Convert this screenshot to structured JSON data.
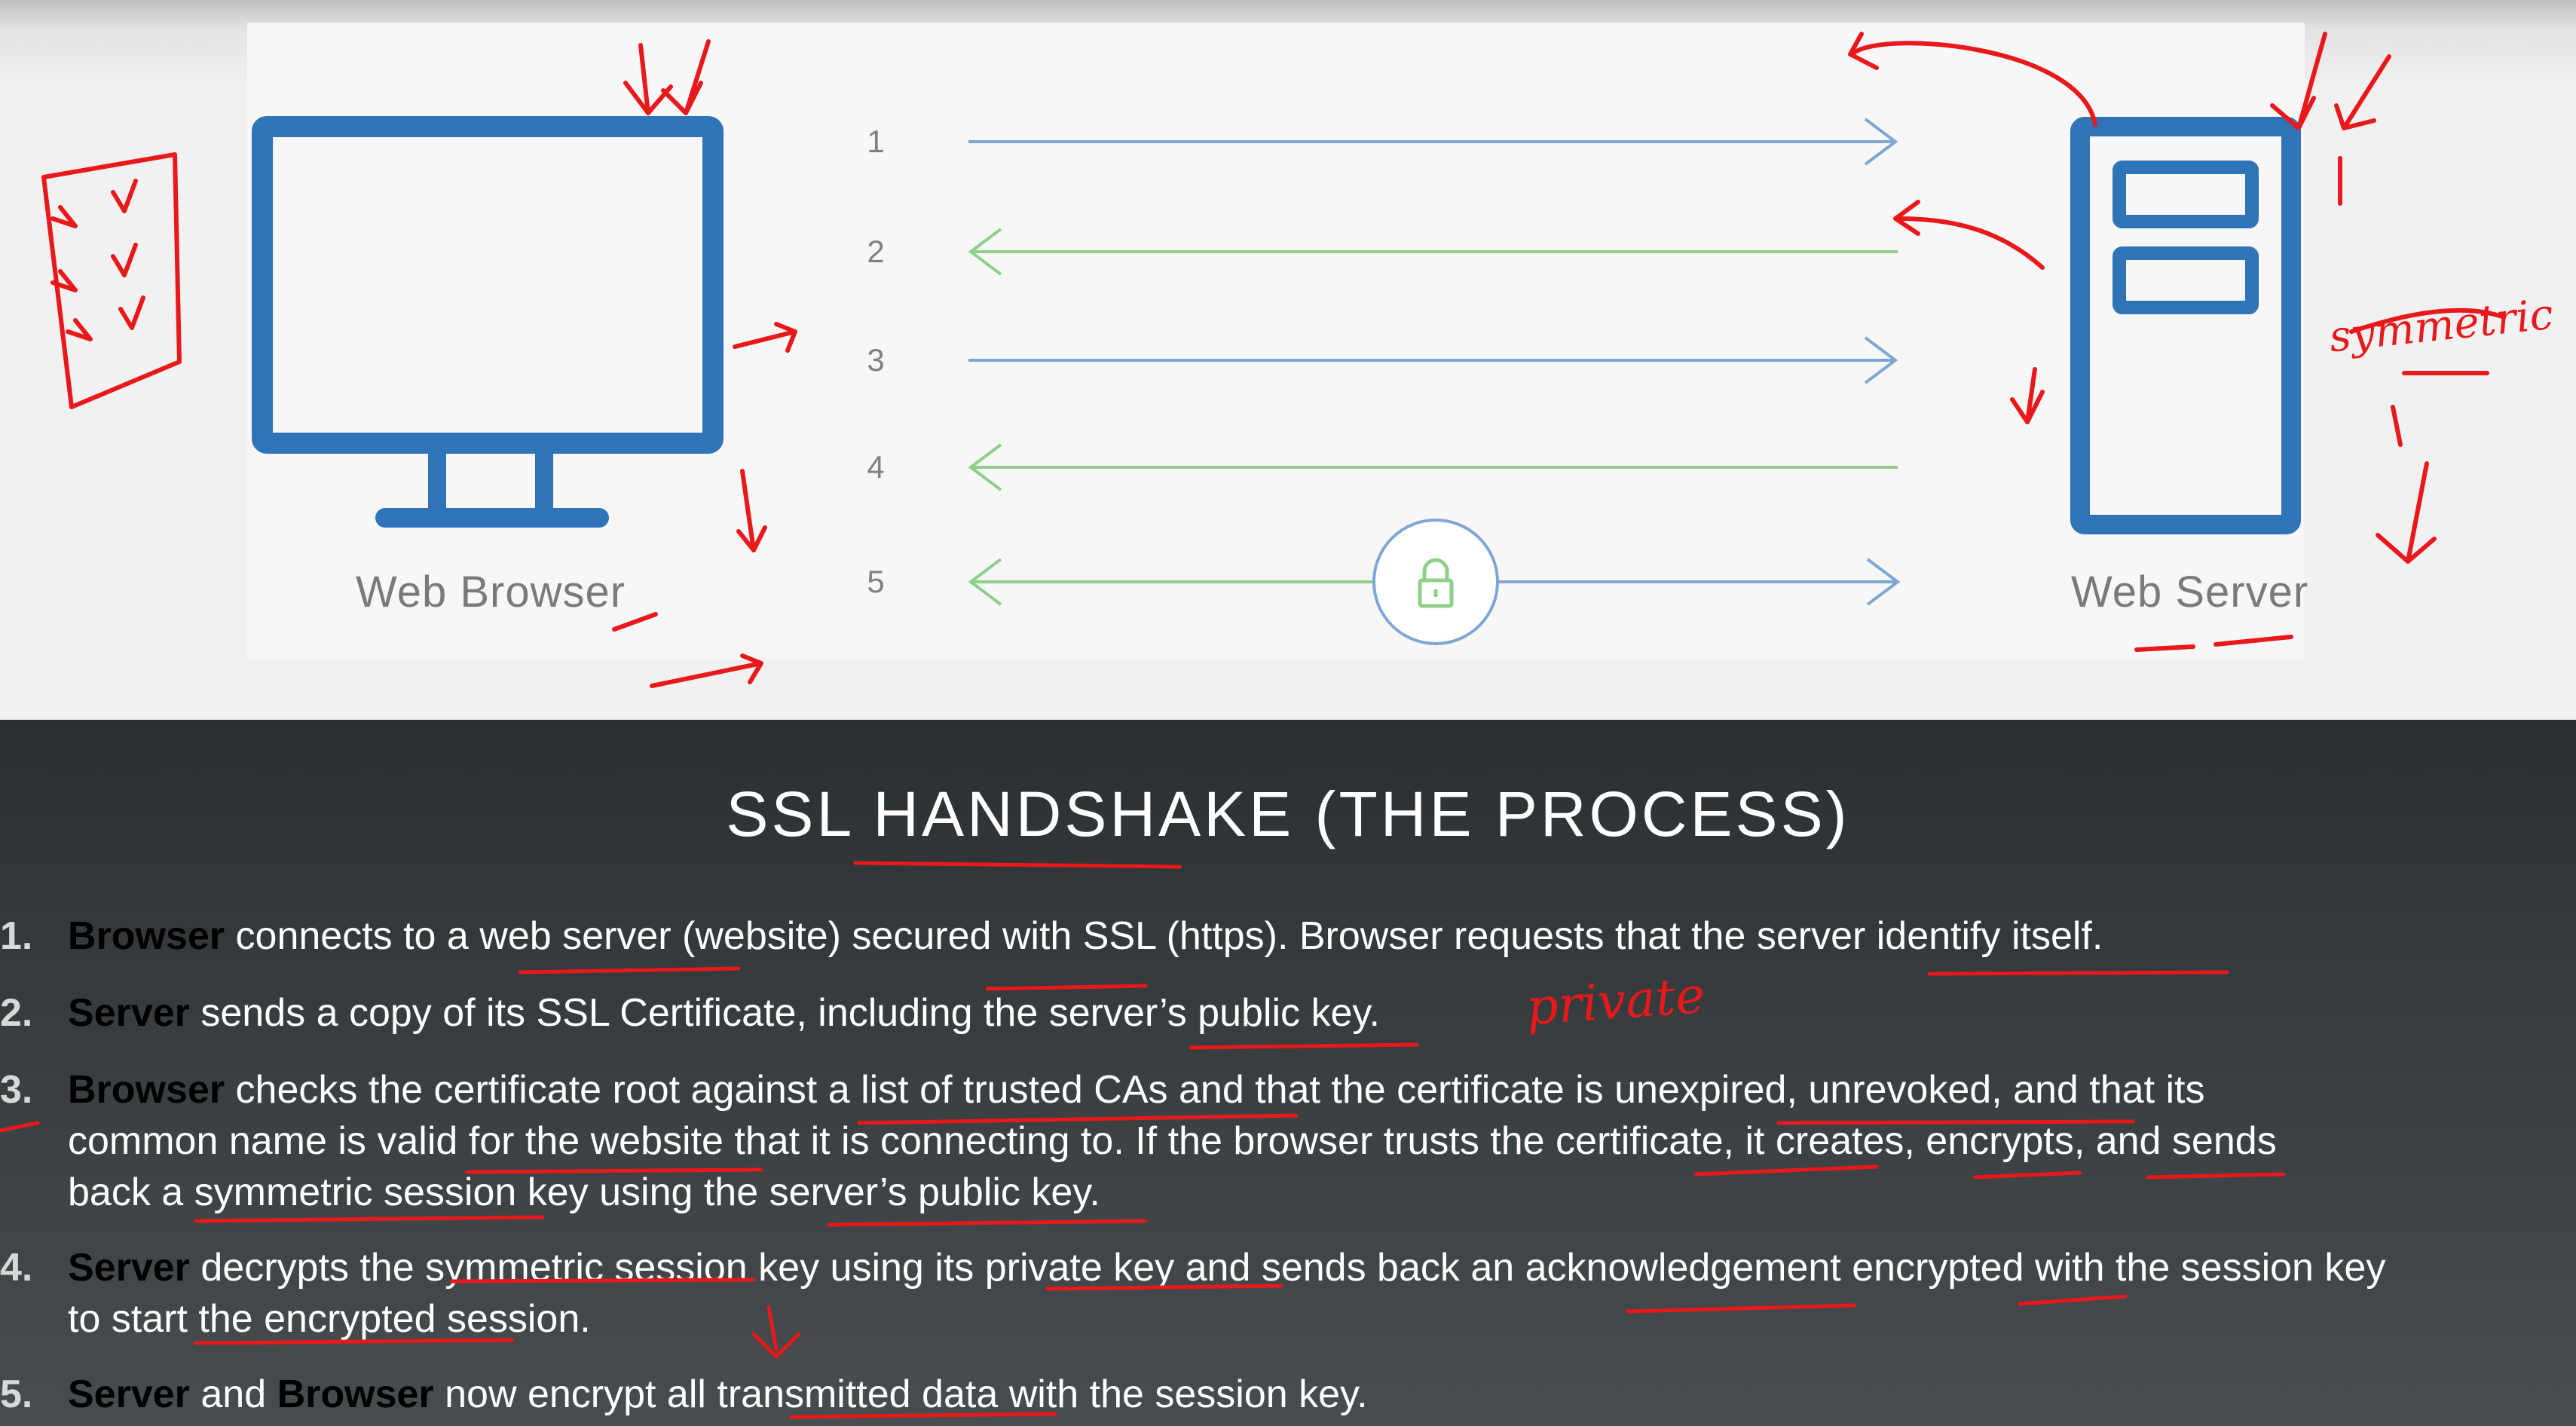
{
  "diagram": {
    "browser_label": "Web Browser",
    "server_label": "Web Server",
    "step_numbers": [
      "1",
      "2",
      "3",
      "4",
      "5"
    ],
    "colors": {
      "blue": "#2f73b8",
      "blue_arrow": "#7fa7d4",
      "green_arrow": "#8fcf8a",
      "annotation": "#e8181b"
    }
  },
  "title": "SSL HANDSHAKE (THE PROCESS)",
  "steps": [
    {
      "num": "1.",
      "lines": [
        {
          "bold": "Browser",
          "text": " connects to a web server (website) secured with SSL (https). Browser requests that the server identify itself."
        }
      ]
    },
    {
      "num": "2.",
      "lines": [
        {
          "bold": "Server",
          "text": " sends a copy of its SSL Certificate, including the server’s public key."
        }
      ]
    },
    {
      "num": "3.",
      "lines": [
        {
          "bold": "Browser",
          "text": " checks the certificate root against a list of trusted CAs and that the certificate is unexpired, unrevoked, and that its"
        },
        {
          "text": "common name is valid for the website that it is connecting to. If the browser trusts the certificate, it creates, encrypts, and sends"
        },
        {
          "text": "back a symmetric session key using the server’s public key."
        }
      ]
    },
    {
      "num": "4.",
      "lines": [
        {
          "bold": "Server",
          "text": " decrypts the symmetric session key using its private key and sends back an acknowledgement encrypted with the session key"
        },
        {
          "text": "to start the encrypted session."
        }
      ]
    },
    {
      "num": "5.",
      "lines": [
        {
          "bold": "Server",
          "text": " and ",
          "bold2": "Browser",
          "text2": " now encrypt all transmitted data with the session key."
        }
      ]
    }
  ],
  "annotations": {
    "private_note": "private",
    "symmetric_note": "symmetric"
  }
}
